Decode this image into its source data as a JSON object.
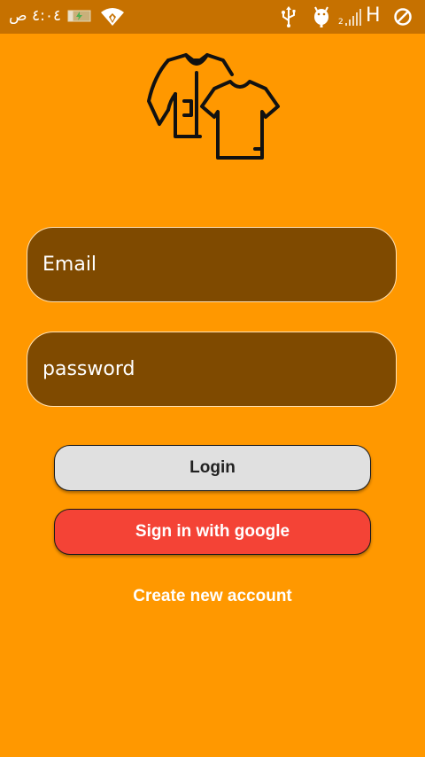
{
  "status_bar": {
    "time": "٤:٠٤ ص",
    "network_label": "H",
    "signal_label": "2",
    "icons": [
      "battery-charging-icon",
      "wifi-icon",
      "usb-icon",
      "android-debug-icon",
      "signal-icon",
      "no-sim-icon"
    ],
    "background_color": "#C67100"
  },
  "logo": {
    "icon": "clothes-icon"
  },
  "form": {
    "email_placeholder": "Email",
    "password_placeholder": "password"
  },
  "buttons": {
    "login_label": "Login",
    "google_label": "Sign in with google"
  },
  "links": {
    "create_account_label": "Create new account"
  },
  "colors": {
    "background": "#FF9800",
    "field_background": "#7F4A00",
    "google_button": "#F44336",
    "login_button": "#E0E0E0"
  }
}
